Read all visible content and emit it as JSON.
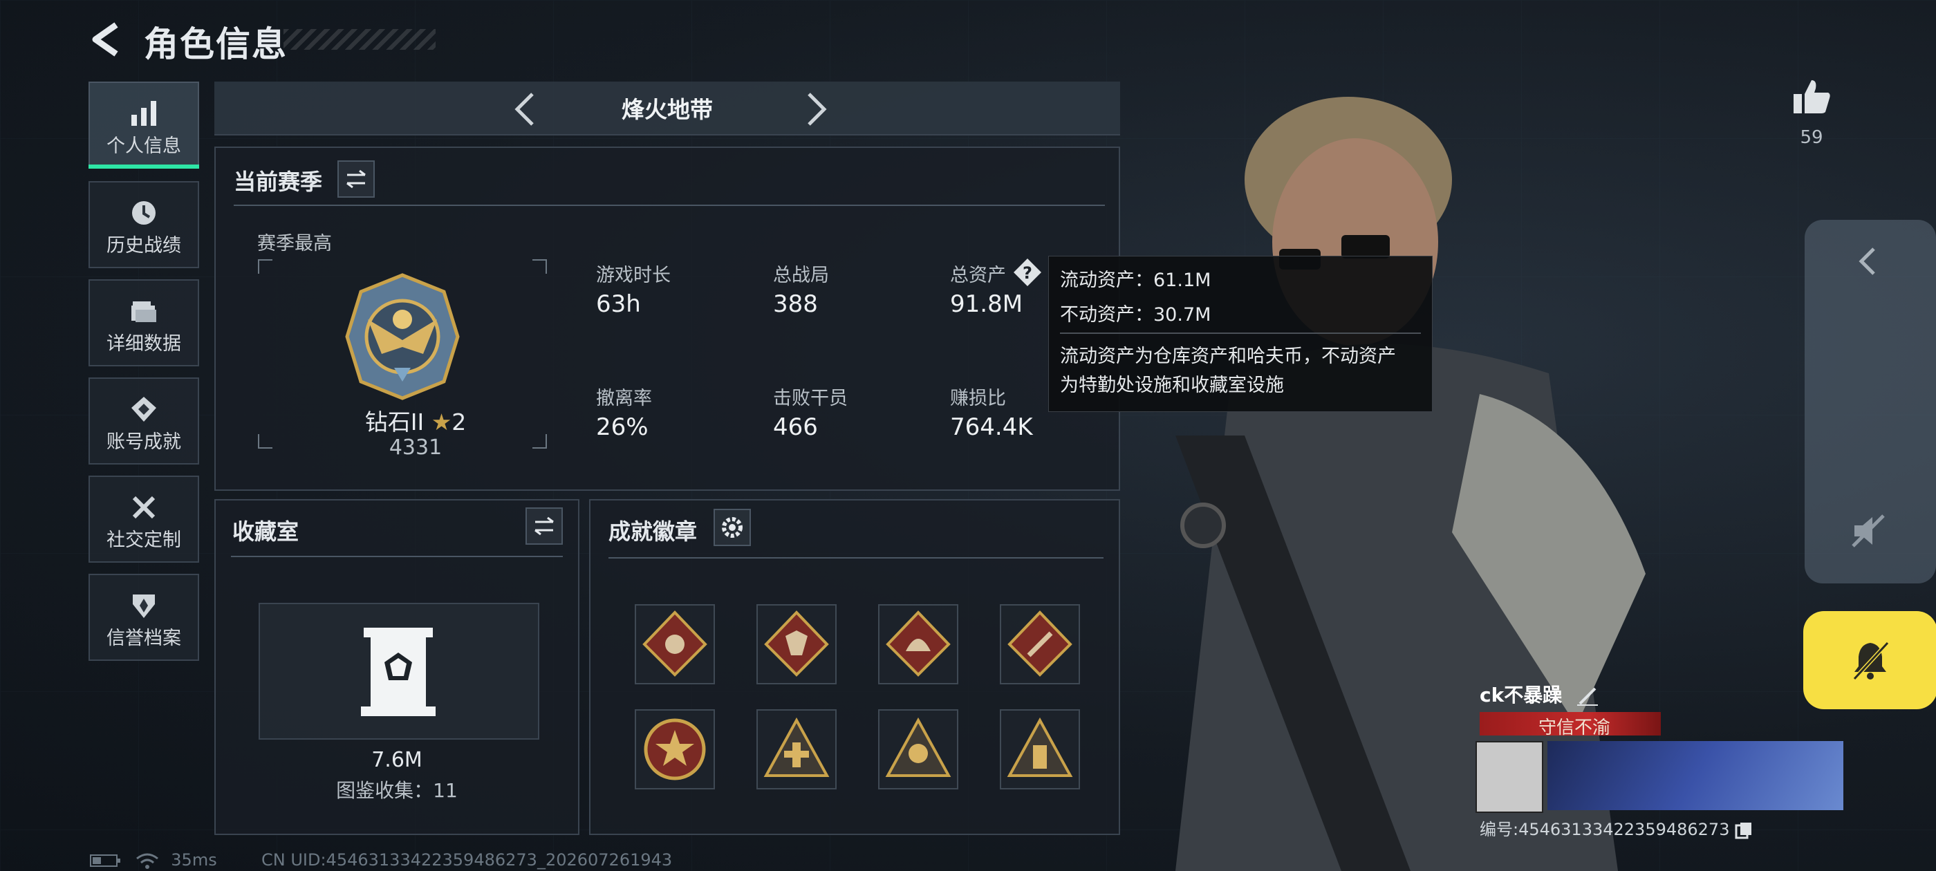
{
  "header": {
    "title": "角色信息"
  },
  "nav": [
    {
      "label": "个人信息",
      "icon": "bar-chart-icon",
      "active": true
    },
    {
      "label": "历史战绩",
      "icon": "clock-history-icon"
    },
    {
      "label": "详细数据",
      "icon": "folder-icon"
    },
    {
      "label": "账号成就",
      "icon": "medal-icon"
    },
    {
      "label": "社交定制",
      "icon": "tools-icon"
    },
    {
      "label": "信誉档案",
      "icon": "shield-icon"
    }
  ],
  "game": {
    "name": "烽火地带"
  },
  "season": {
    "title": "当前赛季",
    "best_label": "赛季最高",
    "rank_name": "钻石II",
    "rank_stars": "2",
    "rank_points": "4331",
    "stats": [
      {
        "label": "游戏时长",
        "value": "63h"
      },
      {
        "label": "总战局",
        "value": "388"
      },
      {
        "label": "总资产",
        "value": "91.8M"
      },
      {
        "label": "撤离率",
        "value": "26%"
      },
      {
        "label": "击败干员",
        "value": "466"
      },
      {
        "label": "赚损比",
        "value": "764.4K"
      }
    ]
  },
  "tooltip": {
    "liquid": "流动资产：61.1M",
    "fixed": "不动资产：30.7M",
    "desc_line1": "流动资产为仓库资产和哈夫币，不动资产",
    "desc_line2": "为特勤处设施和收藏室设施"
  },
  "collection": {
    "title": "收藏室",
    "value": "7.6M",
    "catalog": "图鉴收集：11"
  },
  "achievements": {
    "title": "成就徽章",
    "badges": [
      "runner-badge-icon",
      "wolf-badge-icon",
      "dragon-badge-icon",
      "weapon-badge-icon",
      "star-badge-icon",
      "cross-triangle-badge-icon",
      "squad-triangle-badge-icon",
      "soldier-triangle-badge-icon"
    ]
  },
  "right": {
    "likes": "59"
  },
  "player": {
    "name": "ck不暴躁",
    "title": "守信不渝",
    "id": "编号:454631334223594862​73"
  },
  "status": {
    "ping": "35ms",
    "uid": "CN UID:454631334223594862​73_202607261943"
  },
  "colors": {
    "accent": "#2ee6a6",
    "notify": "#f7df43",
    "rank_gold": "#c9a24a"
  }
}
